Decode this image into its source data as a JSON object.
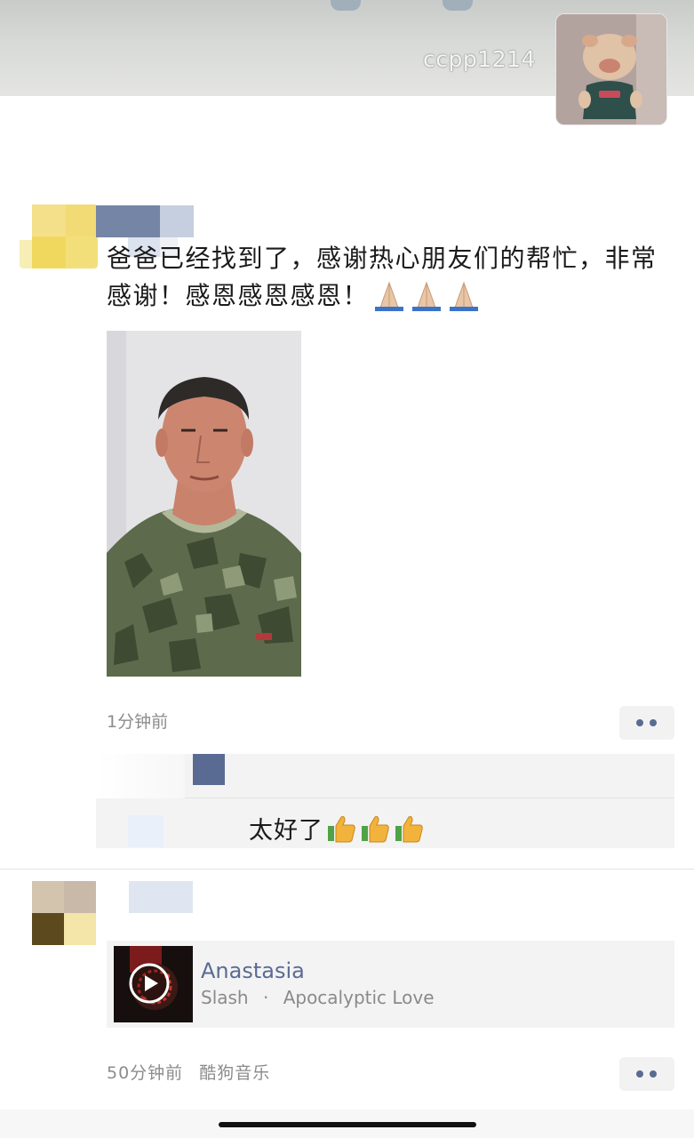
{
  "cover": {
    "username": "ccpp1214"
  },
  "post1": {
    "text": "爸爸已经找到了，感谢热心朋友们的帮忙，非常感谢！感恩感恩感恩！",
    "emoji_icon": "folded-hands-icon",
    "emoji_count": 3,
    "time": "1分钟前",
    "comment": {
      "text": "太好了",
      "emoji_icon": "thumbs-up-icon",
      "emoji_count": 3
    }
  },
  "post2": {
    "music": {
      "title": "Anastasia",
      "artist": "Slash",
      "separator": "·",
      "album": "Apocalyptic Love"
    },
    "time": "50分钟前",
    "source": "酷狗音乐"
  },
  "colors": {
    "link": "#5a6b93",
    "timestamp": "#8c8c8c",
    "card_bg": "#f3f3f3"
  }
}
